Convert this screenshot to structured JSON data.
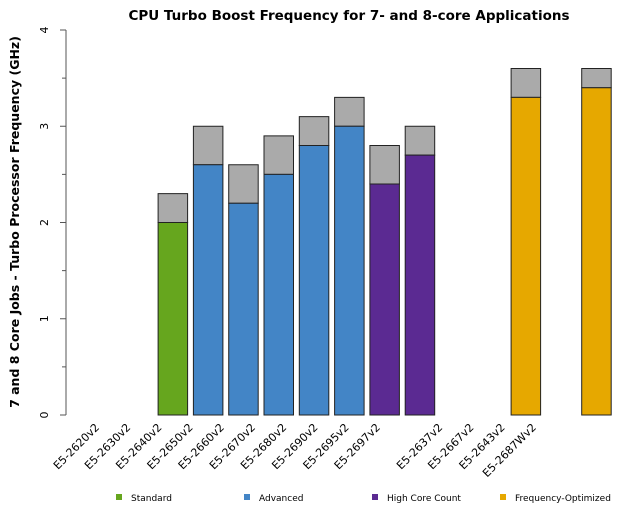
{
  "chart_data": {
    "type": "bar",
    "stacked": true,
    "title": "CPU Turbo Boost Frequency for 7- and 8-core Applications",
    "xlabel": "",
    "ylabel": "7 and 8 Core Jobs - Turbo Processor Frequency (GHz)",
    "ylim": [
      0,
      4
    ],
    "yticks": [
      0,
      1,
      2,
      3,
      4
    ],
    "grid": false,
    "categories": [
      "E5-2620v2",
      "E5-2630v2",
      "E5-2640v2",
      "E5-2650v2",
      "E5-2660v2",
      "E5-2670v2",
      "E5-2680v2",
      "E5-2690v2",
      "E5-2695v2",
      "E5-2697v2",
      "",
      "E5-2637v2",
      "E5-2667v2",
      "E5-2643v2",
      "E5-2687Wv2"
    ],
    "base_frequency": [
      null,
      null,
      2.0,
      2.6,
      2.2,
      2.5,
      2.8,
      3.0,
      2.4,
      2.7,
      null,
      null,
      3.3,
      null,
      3.4
    ],
    "turbo_frequency": [
      null,
      null,
      2.3,
      3.0,
      2.6,
      2.9,
      3.1,
      3.3,
      2.8,
      3.0,
      null,
      null,
      3.6,
      null,
      3.6
    ],
    "group": [
      null,
      null,
      "Standard",
      "Advanced",
      "Advanced",
      "Advanced",
      "Advanced",
      "Advanced",
      "High Core Count",
      "High Core Count",
      null,
      null,
      "Frequency-Optimized",
      null,
      "Frequency-Optimized"
    ],
    "turbo_color": "#aaaaaa",
    "legend_placement": "bottom",
    "legend": [
      {
        "name": "Standard",
        "color": "#66a61e"
      },
      {
        "name": "Advanced",
        "color": "#4385c6"
      },
      {
        "name": "High Core Count",
        "color": "#5b2a92"
      },
      {
        "name": "Frequency-Optimized",
        "color": "#e6a800"
      }
    ]
  }
}
